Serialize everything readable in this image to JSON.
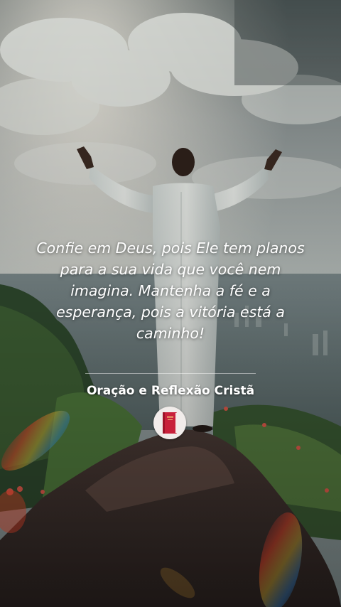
{
  "quote": {
    "line1": "Confie em Deus, pois Ele tem planos",
    "line2": "para a sua vida que você nem",
    "line3": "imagina. Mantenha a fé e a",
    "line4": "esperança, pois a vitória está a",
    "line5": "caminho!"
  },
  "source": {
    "name": "Oração e Reflexão Cristã",
    "avatar_icon": "red-bible-icon"
  },
  "colors": {
    "text": "#ffffff",
    "robe": "#e8ebe6",
    "bible": "#c8203a"
  }
}
